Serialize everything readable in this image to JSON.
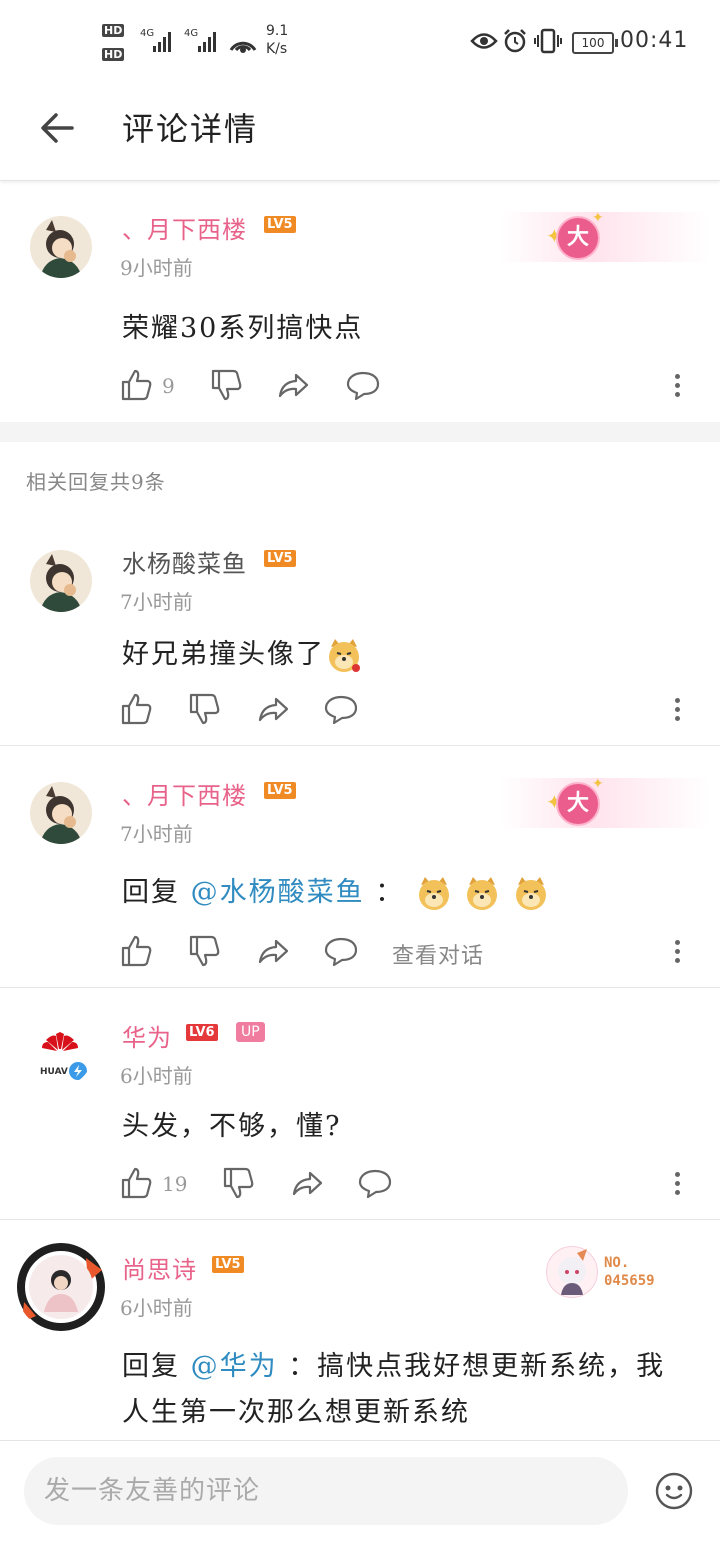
{
  "status_bar": {
    "hd1": "HD",
    "hd2": "HD",
    "net1": "4G",
    "net2": "4G",
    "speed_value": "9.1",
    "speed_unit": "K/s",
    "battery": "100",
    "time": "00:41"
  },
  "header": {
    "title": "评论详情"
  },
  "main_comment": {
    "username": "、月下西楼",
    "level": "LV5",
    "badge": "大",
    "time": "9小时前",
    "content": "荣耀30系列搞快点",
    "likes": "9"
  },
  "replies_header": "相关回复共9条",
  "replies": [
    {
      "username": "水杨酸菜鱼",
      "level": "LV5",
      "time": "7小时前",
      "content": "好兄弟撞头像了"
    },
    {
      "username": "、月下西楼",
      "level": "LV5",
      "badge": "大",
      "time": "7小时前",
      "reply_prefix": "回复",
      "mention": "@水杨酸菜鱼",
      "colon": "：",
      "view_conversation": "查看对话"
    },
    {
      "username": "华为",
      "level": "LV6",
      "up_tag": "UP",
      "avatar_text": "HUAV",
      "time": "6小时前",
      "content": "头发，不够，懂?",
      "likes": "19"
    },
    {
      "username": "尚思诗",
      "level": "LV5",
      "time": "6小时前",
      "reply_prefix": "回复",
      "mention": "@华为",
      "content_line1": "：搞快点我好想更新系统，我",
      "content_line2": "人生第一次那么想更新系统",
      "badge_no_label": "NO.",
      "badge_no_value": "045659"
    }
  ],
  "bottom": {
    "input_placeholder": "发一条友善的评论"
  },
  "colors": {
    "pink_name": "#e8638a",
    "mention": "#2f8bc0",
    "level_badge": "#f08a25",
    "up_badge": "#f07ca0"
  }
}
